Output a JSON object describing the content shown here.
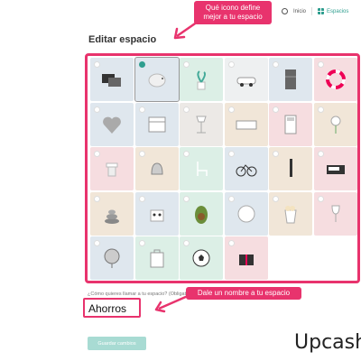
{
  "nav": {
    "items": [
      {
        "label": "Inicio",
        "icon": "person-icon",
        "active": false
      },
      {
        "label": "Espacios",
        "icon": "grid-icon",
        "active": true
      }
    ]
  },
  "page": {
    "title": "Editar espacio",
    "name_prompt": "¿Cómo quieres llamar a tu espacio? (Obligatorio)",
    "name_value": "Ahorros",
    "save_label": "Guardar cambios"
  },
  "callouts": {
    "icon_tip": "Qué icono define mejor a tu espacio",
    "name_tip": "Dale un nombre a tu espacio"
  },
  "brand": {
    "text": "Upcashv"
  },
  "colors": {
    "accent": "#e8336d",
    "teal": "#2f9e8f"
  },
  "icons": [
    {
      "name": "cards-icon",
      "bg": "#dfe7ee",
      "selected": false
    },
    {
      "name": "piggy-bank-icon",
      "bg": "#dfe7ee",
      "selected": true
    },
    {
      "name": "plant-icon",
      "bg": "#dcefe6",
      "selected": false
    },
    {
      "name": "car-icon",
      "bg": "#eef0f1",
      "selected": false
    },
    {
      "name": "fridge-icon",
      "bg": "#dfe7ee",
      "selected": false
    },
    {
      "name": "lifebuoy-icon",
      "bg": "#f6dde0",
      "selected": false
    },
    {
      "name": "heart-icon",
      "bg": "#dfe7ee",
      "selected": false
    },
    {
      "name": "calendar-icon",
      "bg": "#dfe7ee",
      "selected": false
    },
    {
      "name": "lamp-icon",
      "bg": "#ece9e6",
      "selected": false
    },
    {
      "name": "keyboard-icon",
      "bg": "#f1e6d8",
      "selected": false
    },
    {
      "name": "calculator-icon",
      "bg": "#f6dde0",
      "selected": false
    },
    {
      "name": "flowers-icon",
      "bg": "#f1e6d8",
      "selected": false
    },
    {
      "name": "table-icon",
      "bg": "#f6dde0",
      "selected": false
    },
    {
      "name": "bell-icon",
      "bg": "#f1e6d8",
      "selected": false
    },
    {
      "name": "chair-icon",
      "bg": "#dcefe6",
      "selected": false
    },
    {
      "name": "bicycle-icon",
      "bg": "#dfe7ee",
      "selected": false
    },
    {
      "name": "pen-icon",
      "bg": "#f1e6d8",
      "selected": false
    },
    {
      "name": "radio-icon",
      "bg": "#f6dde0",
      "selected": false
    },
    {
      "name": "stones-icon",
      "bg": "#f1e6d8",
      "selected": false
    },
    {
      "name": "bag-icon",
      "bg": "#dfe7ee",
      "selected": false
    },
    {
      "name": "avocado-icon",
      "bg": "#dcefe6",
      "selected": false
    },
    {
      "name": "ball-icon",
      "bg": "#dfe7ee",
      "selected": false
    },
    {
      "name": "popcorn-icon",
      "bg": "#f1e6d8",
      "selected": false
    },
    {
      "name": "wine-icon",
      "bg": "#f6dde0",
      "selected": false
    },
    {
      "name": "globe-icon",
      "bg": "#dfe7ee",
      "selected": false
    },
    {
      "name": "suitcase-icon",
      "bg": "#dcefe6",
      "selected": false
    },
    {
      "name": "soccer-ball-icon",
      "bg": "#dcefe6",
      "selected": false
    },
    {
      "name": "gift-icon",
      "bg": "#f6dde0",
      "selected": false
    }
  ]
}
